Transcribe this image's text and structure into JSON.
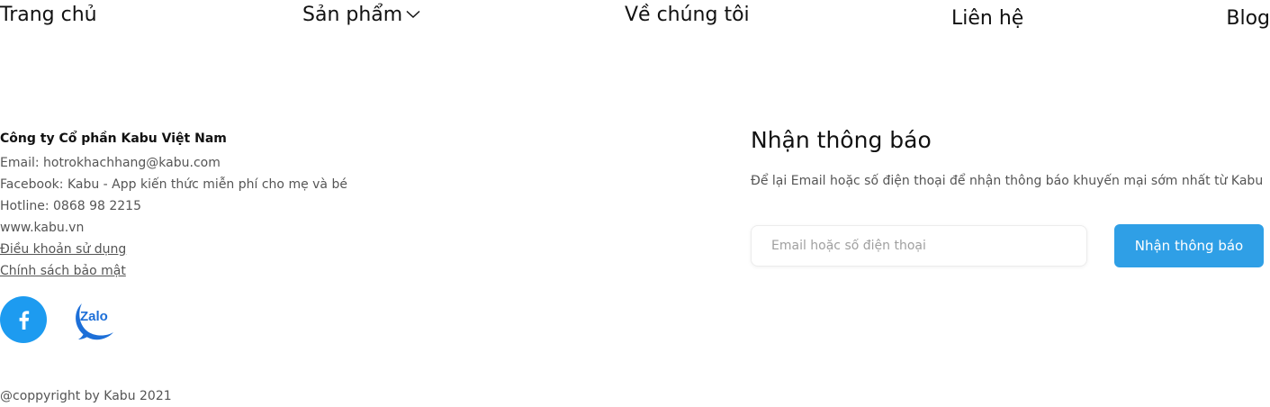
{
  "nav": {
    "home": "Trang chủ",
    "products": "Sản phẩm",
    "about": "Về chúng tôi",
    "contact": "Liên hệ",
    "blog": "Blog"
  },
  "company": {
    "name": "Công ty Cổ phần Kabu Việt Nam",
    "email": "Email: hotrokhachhang@kabu.com",
    "facebook": "Facebook: Kabu - App kiến thức miễn phí cho mẹ và bé",
    "hotline": "Hotline: 0868 98 2215",
    "website": "www.kabu.vn",
    "terms": "Điều khoản sử dụng",
    "privacy": "Chính sách bảo mật"
  },
  "social": {
    "facebook_icon": "facebook-icon",
    "zalo_icon": "zalo-icon",
    "zalo_text": "Zalo",
    "facebook_color": "#1d9bf0",
    "zalo_color": "#1d6fd8"
  },
  "newsletter": {
    "title": "Nhận thông báo",
    "description": "Để lại Email hoặc số điện thoại để nhận thông báo khuyến mại sớm nhất từ Kabu",
    "input_placeholder": "Email hoặc số điện thoại",
    "input_value": "",
    "button_label": "Nhận thông báo",
    "button_color": "#2f9fe6"
  },
  "copyright": "@coppyright by Kabu 2021"
}
